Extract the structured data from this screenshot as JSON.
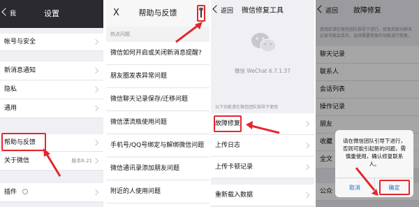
{
  "panel1": {
    "back_label": "我",
    "title": "设置",
    "items": [
      {
        "label": "帐号与安全"
      },
      {
        "label": "新消息通知"
      },
      {
        "label": "隐私"
      },
      {
        "label": "通用"
      },
      {
        "label": "帮助与反馈"
      },
      {
        "label": "关于微信",
        "value": "版本6.21"
      },
      {
        "label": "插件"
      }
    ]
  },
  "panel2": {
    "close_label": "X",
    "title": "帮助与反馈",
    "section_label": "热点问题",
    "items": [
      {
        "label": "微信如何开启或关闭新消息提醒?"
      },
      {
        "label": "朋友圈发表异常问题"
      },
      {
        "label": "微信聊天记录保存/迁移问题"
      },
      {
        "label": "微信漂流瓶使用问题"
      },
      {
        "label": "手机号/QQ号绑定与解绑微信问题"
      },
      {
        "label": "微信通讯录添加朋友问题"
      },
      {
        "label": "附近的人使用问题"
      }
    ]
  },
  "panel3": {
    "back_label": "返回",
    "title": "微信修复工具",
    "version_text": "微信 WeChat 6.7.1.37",
    "section_label": "以下功能请在微信团队指导下使用",
    "items": [
      {
        "label": "故障修复"
      },
      {
        "label": "上传日志"
      },
      {
        "label": "上传卡顿记录"
      },
      {
        "label": "重新载入数据"
      }
    ]
  },
  "panel4": {
    "back_label": "返回",
    "title": "故障修复",
    "description": "使用前请在微信团队指导下进行。修复后部分聊天记录可能会丢失，选择需要修复的功能进行修复。",
    "items": [
      {
        "label": "聊天记录"
      },
      {
        "label": "联系人"
      },
      {
        "label": "会话列表"
      },
      {
        "label": "操作记录"
      },
      {
        "label": "朋友"
      },
      {
        "label": "收藏"
      },
      {
        "label": "全文"
      },
      {
        "label": "公众"
      }
    ],
    "dialog": {
      "message": "请在微信团队引导下进行，否则可能引起新的问题，需慎重使用，确认修复联系人。",
      "cancel_label": "取消",
      "confirm_label": "确定"
    }
  },
  "colors": {
    "nav_bg": "#2b2a30",
    "highlight_red": "#e3262e",
    "link_blue": "#1a73c9"
  }
}
